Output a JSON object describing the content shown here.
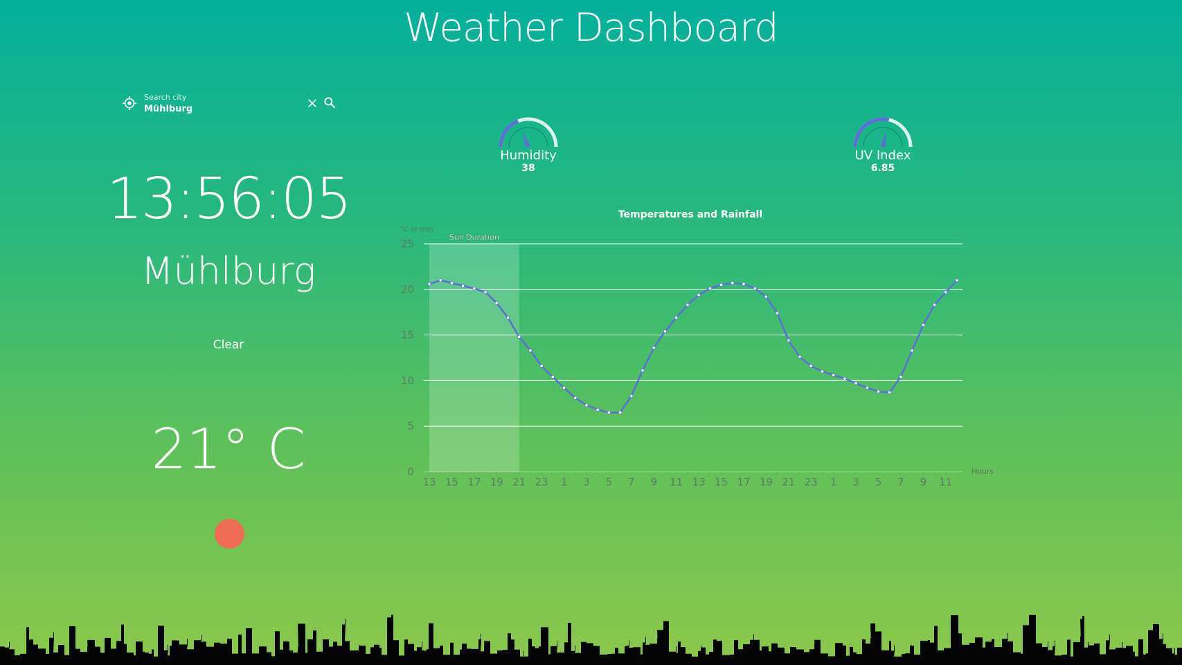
{
  "app": {
    "title": "Weather Dashboard"
  },
  "search": {
    "label": "Search city",
    "value": "Mühlburg"
  },
  "current": {
    "time": "13:56:05",
    "city": "Mühlburg",
    "condition": "Clear",
    "temperature": "21° C"
  },
  "gauges": {
    "humidity": {
      "label": "Humidity",
      "value": "38",
      "fraction": 0.38
    },
    "uv": {
      "label": "UV Index",
      "value": "6.85",
      "fraction": 0.57
    }
  },
  "colors": {
    "accent": "#5b6fd6",
    "sun": "#ee6c54",
    "sun_band": "rgba(255,255,255,0.2)"
  },
  "chart_data": {
    "type": "line",
    "title": "Temperatures and Rainfall",
    "ylabel": "°C or mm",
    "xlabel": "Hours",
    "ylim": [
      0,
      25
    ],
    "yticks": [
      0,
      5,
      10,
      15,
      20,
      25
    ],
    "band_label": "Sun Duration",
    "band": [
      13,
      21
    ],
    "categories": [
      "13",
      "14",
      "15",
      "16",
      "17",
      "18",
      "19",
      "20",
      "21",
      "22",
      "23",
      "0",
      "1",
      "2",
      "3",
      "4",
      "5",
      "6",
      "7",
      "8",
      "9",
      "10",
      "11",
      "12",
      "13",
      "14",
      "15",
      "16",
      "17",
      "18",
      "19",
      "20",
      "21",
      "22",
      "23",
      "0",
      "1",
      "2",
      "3",
      "4",
      "5",
      "6",
      "7",
      "8",
      "9",
      "10",
      "11",
      "12"
    ],
    "series": [
      {
        "values": [
          20.6,
          21.0,
          20.7,
          20.4,
          20.1,
          19.7,
          18.5,
          16.9,
          14.8,
          13.3,
          11.6,
          10.4,
          9.2,
          8.1,
          7.3,
          6.8,
          6.5,
          6.5,
          8.3,
          11.1,
          13.6,
          15.4,
          16.9,
          18.3,
          19.4,
          20.1,
          20.5,
          20.7,
          20.6,
          20.1,
          19.2,
          17.4,
          14.4,
          12.6,
          11.6,
          11.0,
          10.6,
          10.2,
          9.7,
          9.2,
          8.8,
          8.7,
          10.4,
          13.3,
          16.1,
          18.3,
          19.7,
          21.0
        ]
      }
    ],
    "grid": true
  }
}
